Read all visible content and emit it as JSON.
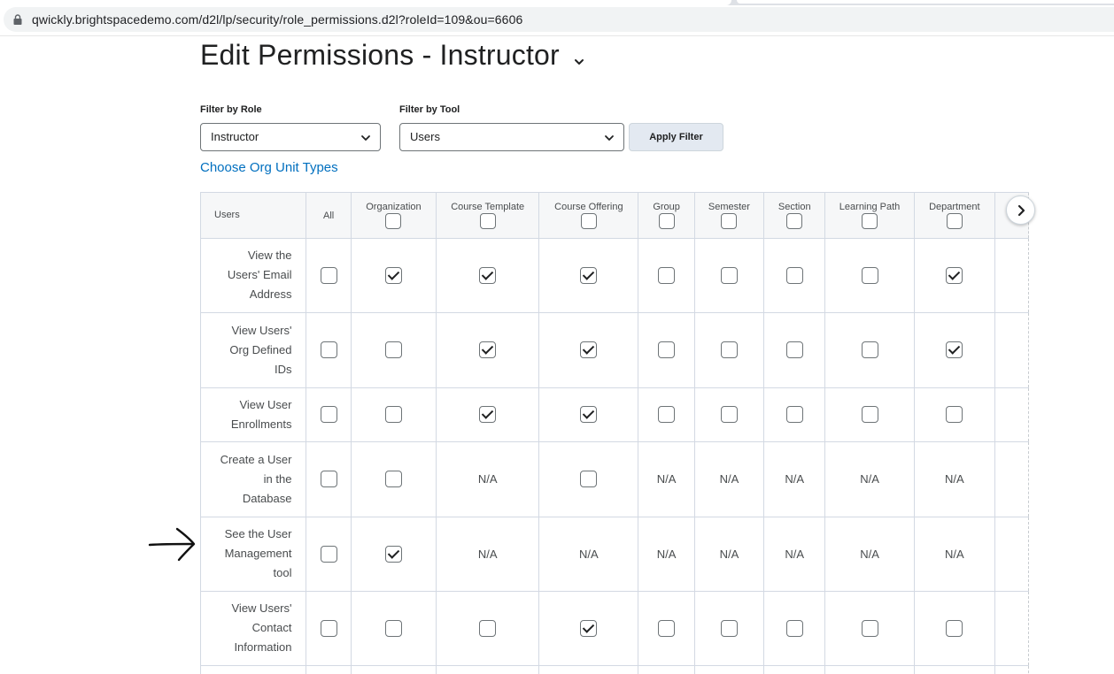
{
  "browser": {
    "url": "qwickly.brightspacedemo.com/d2l/lp/security/role_permissions.d2l?roleId=109&ou=6606"
  },
  "page": {
    "title": "Edit Permissions - Instructor"
  },
  "filters": {
    "role_label": "Filter by Role",
    "role_value": "Instructor",
    "tool_label": "Filter by Tool",
    "tool_value": "Users",
    "apply_label": "Apply Filter",
    "org_link": "Choose Org Unit Types"
  },
  "grid": {
    "corner": "Users",
    "columns": [
      "All",
      "Organization",
      "Course Template",
      "Course Offering",
      "Group",
      "Semester",
      "Section",
      "Learning Path",
      "Department"
    ],
    "rows": [
      {
        "label": [
          "View the",
          "Users' Email",
          "Address"
        ],
        "cells": [
          "off",
          "on",
          "on",
          "on",
          "off",
          "off",
          "off",
          "off",
          "on"
        ]
      },
      {
        "label": [
          "View Users'",
          "Org Defined",
          "IDs"
        ],
        "cells": [
          "off",
          "off",
          "on",
          "on",
          "off",
          "off",
          "off",
          "off",
          "on"
        ]
      },
      {
        "label": [
          "View User",
          "Enrollments"
        ],
        "cells": [
          "off",
          "off",
          "on",
          "on",
          "off",
          "off",
          "off",
          "off",
          "off"
        ]
      },
      {
        "label": [
          "Create a User",
          "in the",
          "Database"
        ],
        "cells": [
          "off",
          "off",
          "N/A",
          "off",
          "N/A",
          "N/A",
          "N/A",
          "N/A",
          "N/A"
        ]
      },
      {
        "label": [
          "See the User",
          "Management",
          "tool"
        ],
        "cells": [
          "off",
          "on",
          "N/A",
          "N/A",
          "N/A",
          "N/A",
          "N/A",
          "N/A",
          "N/A"
        ]
      },
      {
        "label": [
          "View Users'",
          "Contact",
          "Information"
        ],
        "cells": [
          "off",
          "off",
          "off",
          "on",
          "off",
          "off",
          "off",
          "off",
          "off"
        ]
      },
      {
        "label": [],
        "cells": [
          "",
          "",
          "",
          "",
          "",
          "",
          "",
          "",
          ""
        ]
      }
    ]
  },
  "icons": {
    "lock": "lock-icon",
    "title_menu": "chevron-down-icon",
    "next": "chevron-right-icon",
    "annotation": "hand-drawn-arrow-icon"
  },
  "colors": {
    "link": "#006fbf",
    "header_bg": "#f6f7f8",
    "border": "#d3d9e3",
    "button_bg": "#e3e9f1"
  }
}
